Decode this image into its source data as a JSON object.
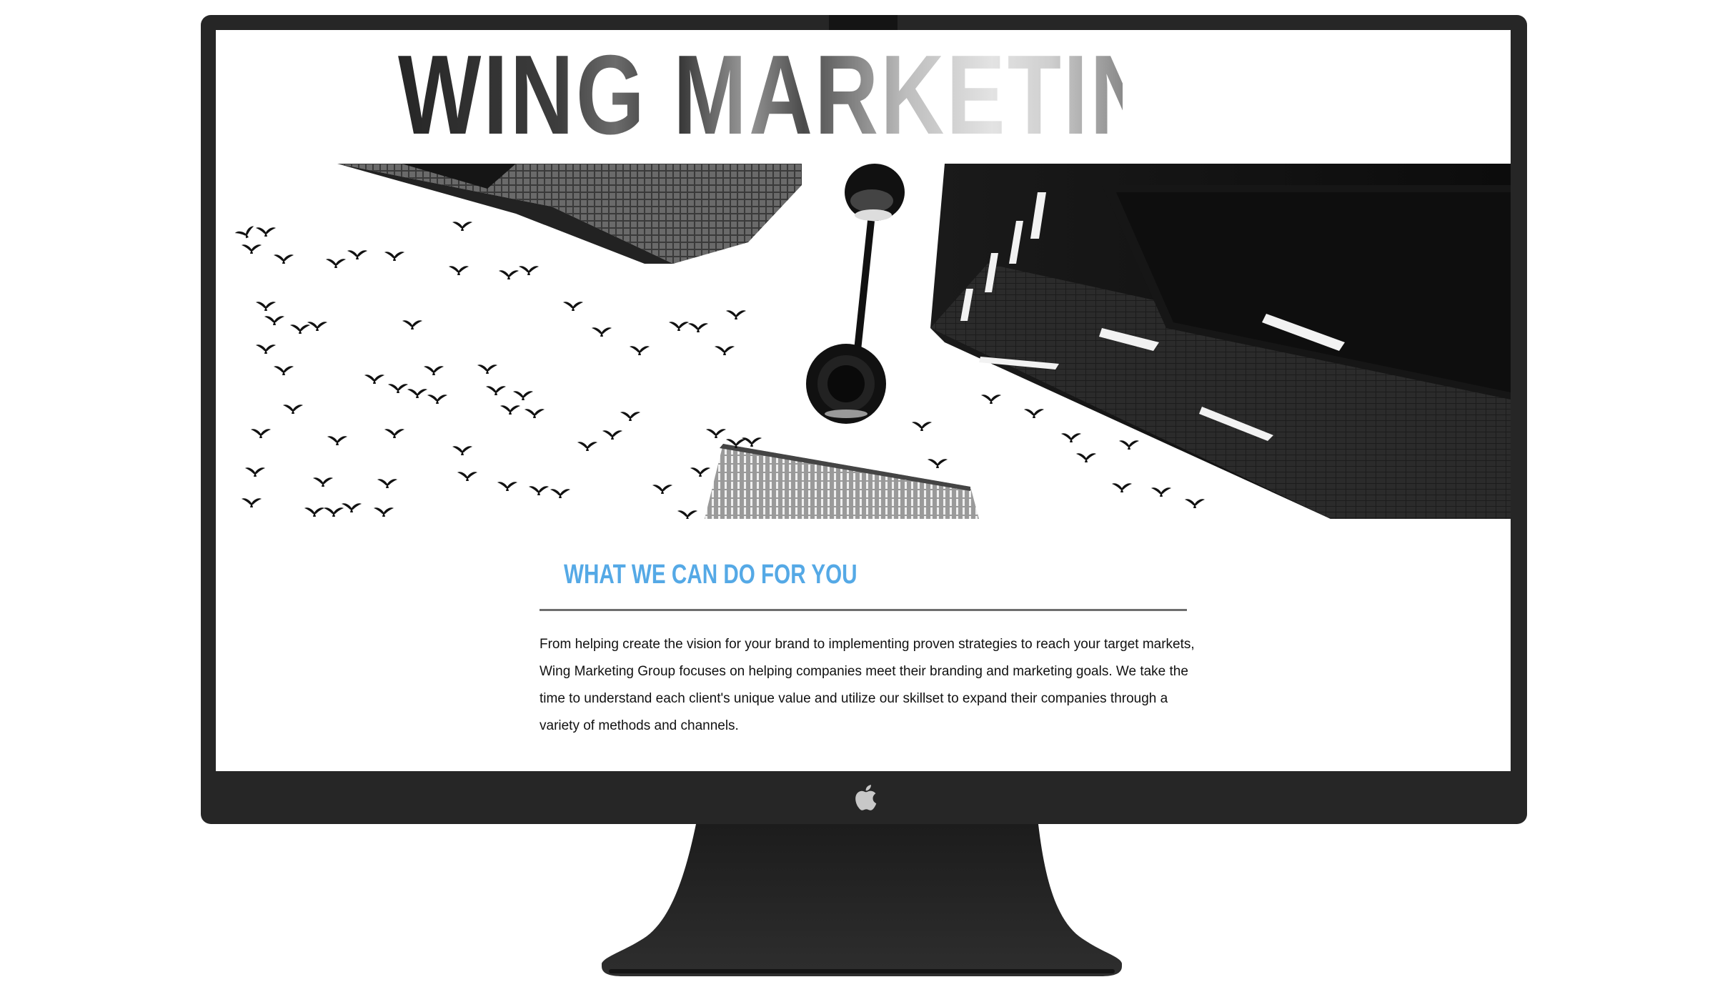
{
  "site": {
    "title": "WING MARKETING GROUP"
  },
  "section": {
    "heading": "WHAT WE CAN DO FOR YOU",
    "body": "From helping create the vision for your brand to implementing proven strategies to reach your target markets, Wing Marketing Group focuses on helping companies meet their branding and marketing goals. We take the time to understand each client's unique value and utilize our skillset to expand their companies through a variety of methods and channels."
  },
  "colors": {
    "heading_accent": "#55a9e6",
    "monitor_frame": "#262626",
    "body_text": "#111111"
  },
  "icons": {
    "monitor_logo": "apple-icon"
  }
}
